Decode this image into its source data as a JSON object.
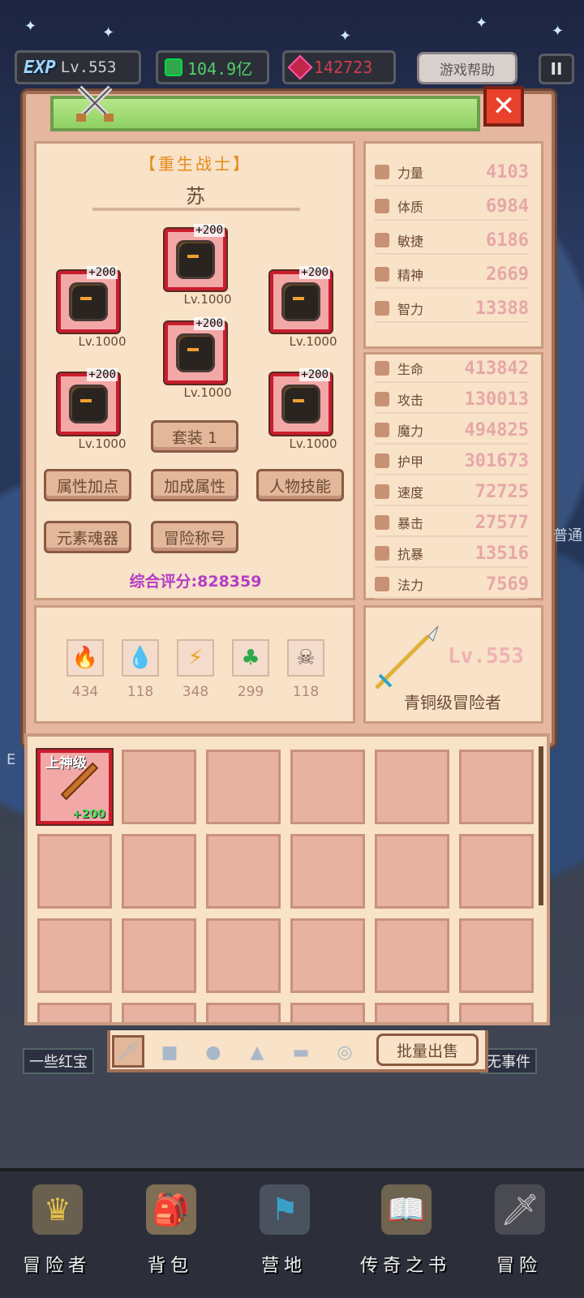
{
  "hud": {
    "exp_badge": "EXP",
    "level": "Lv.553",
    "gold": "104.9亿",
    "gems": "142723",
    "help_label": "游戏帮助",
    "pause_label": "II"
  },
  "character": {
    "title": "【重生战士】",
    "name": "苏",
    "equipment": [
      {
        "slot": "helmet",
        "plus": "+200",
        "level": "Lv.1000"
      },
      {
        "slot": "weapon",
        "plus": "+200",
        "level": "Lv.1000"
      },
      {
        "slot": "shield",
        "plus": "+200",
        "level": "Lv.1000"
      },
      {
        "slot": "armor",
        "plus": "+200",
        "level": "Lv.1000"
      },
      {
        "slot": "gloves",
        "plus": "+200",
        "level": "Lv.1000"
      },
      {
        "slot": "boots",
        "plus": "+200",
        "level": "Lv.1000"
      }
    ],
    "set_label": "套装 1",
    "buttons": [
      "属性加点",
      "加成属性",
      "人物技能",
      "元素魂器",
      "冒险称号"
    ],
    "score": "综合评分:828359"
  },
  "elements": [
    {
      "name": "fire",
      "value": "434"
    },
    {
      "name": "water",
      "value": "118"
    },
    {
      "name": "lightning",
      "value": "348"
    },
    {
      "name": "earth",
      "value": "299"
    },
    {
      "name": "dark",
      "value": "118"
    }
  ],
  "base_stats": [
    {
      "label": "力量",
      "value": "4103"
    },
    {
      "label": "体质",
      "value": "6984"
    },
    {
      "label": "敏捷",
      "value": "6186"
    },
    {
      "label": "精神",
      "value": "2669"
    },
    {
      "label": "智力",
      "value": "13388"
    }
  ],
  "combat_stats": [
    {
      "label": "生命",
      "value": "413842"
    },
    {
      "label": "攻击",
      "value": "130013"
    },
    {
      "label": "魔力",
      "value": "494825"
    },
    {
      "label": "护甲",
      "value": "301673"
    },
    {
      "label": "速度",
      "value": "72725"
    },
    {
      "label": "暴击",
      "value": "27577"
    },
    {
      "label": "抗暴",
      "value": "13516"
    },
    {
      "label": "法力",
      "value": "7569"
    }
  ],
  "rank": {
    "level": "Lv.553",
    "title": "青铜级冒险者"
  },
  "inventory": {
    "first_item": {
      "tier": "上神级",
      "plus": "+200"
    },
    "sell_label": "批量出售"
  },
  "side": {
    "left_label": "一些红宝",
    "right_label": "无事件",
    "edge_right": "普通",
    "edge_left": "E"
  },
  "nav": [
    "冒险者",
    "背包",
    "营地",
    "传奇之书",
    "冒险"
  ],
  "colors": {
    "accent": "#c91d2d",
    "panel": "#e6b79f",
    "score": "#b43ec6"
  }
}
